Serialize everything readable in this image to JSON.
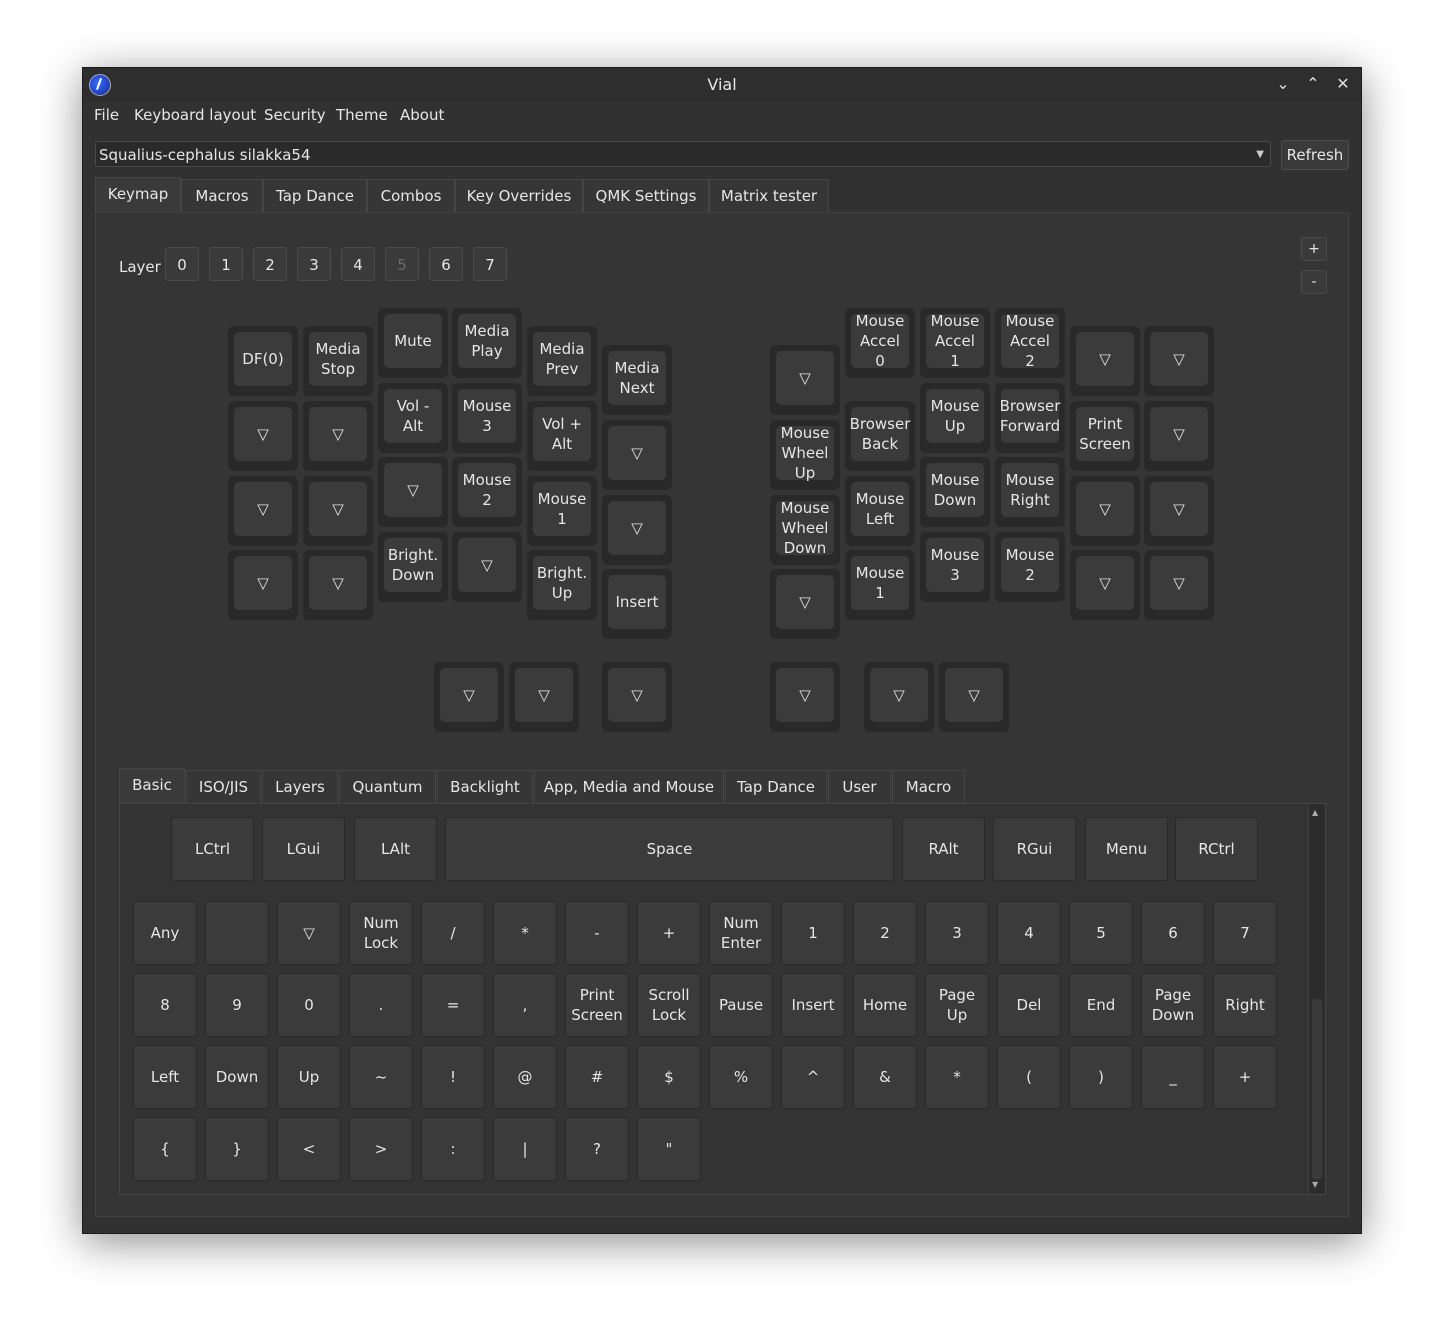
{
  "window": {
    "title": "Vial"
  },
  "menu": [
    "File",
    "Keyboard layout",
    "Security",
    "Theme",
    "About"
  ],
  "keyboard_selector": {
    "value": "Squalius-cephalus silakka54",
    "refresh_label": "Refresh"
  },
  "main_tabs": [
    "Keymap",
    "Macros",
    "Tap Dance",
    "Combos",
    "Key Overrides",
    "QMK Settings",
    "Matrix tester"
  ],
  "layer": {
    "label": "Layer",
    "buttons": [
      "0",
      "1",
      "2",
      "3",
      "4",
      "5",
      "6",
      "7"
    ],
    "plus": "+",
    "minus": "-"
  },
  "keymap_keys": [
    "DF(0)",
    "Media\nStop",
    "Mute",
    "Media\nPlay",
    "Media\nPrev",
    "Media\nNext",
    "▽",
    "▽",
    "Vol -\nAlt",
    "Mouse\n3",
    "Vol +\nAlt",
    "▽",
    "▽",
    "▽",
    "▽",
    "Mouse\n2",
    "Mouse\n1",
    "▽",
    "▽",
    "▽",
    "Bright.\nDown",
    "▽",
    "Bright.\nUp",
    "Insert",
    "▽",
    "Mouse\nAccel\n0",
    "Mouse\nAccel\n1",
    "Mouse\nAccel\n2",
    "▽",
    "▽",
    "Mouse\nWheel\nUp",
    "Browser\nBack",
    "Mouse\nUp",
    "Browser\nForward",
    "Print\nScreen",
    "▽",
    "Mouse\nWheel\nDown",
    "Mouse\nLeft",
    "Mouse\nDown",
    "Mouse\nRight",
    "▽",
    "▽",
    "▽",
    "Mouse\n1",
    "Mouse\n3",
    "Mouse\n2",
    "▽",
    "▽",
    "▽",
    "▽",
    "▽",
    "▽",
    "▽",
    "▽"
  ],
  "picker_tabs": [
    "Basic",
    "ISO/JIS",
    "Layers",
    "Quantum",
    "Backlight",
    "App, Media and Mouse",
    "Tap Dance",
    "User",
    "Macro"
  ],
  "picker_row_bottom": [
    "LCtrl",
    "LGui",
    "LAlt",
    "Space",
    "RAlt",
    "RGui",
    "Menu",
    "RCtrl"
  ],
  "picker_keys": [
    "Any",
    "",
    "▽",
    "Num\nLock",
    "/",
    "*",
    "-",
    "+",
    "Num\nEnter",
    "1",
    "2",
    "3",
    "4",
    "5",
    "6",
    "7",
    "8",
    "9",
    "0",
    ".",
    "=",
    ",",
    "Print\nScreen",
    "Scroll\nLock",
    "Pause",
    "Insert",
    "Home",
    "Page\nUp",
    "Del",
    "End",
    "Page\nDown",
    "Right",
    "Left",
    "Down",
    "Up",
    "~",
    "!",
    "@",
    "#",
    "$",
    "%",
    "^",
    "&",
    "*",
    "(",
    ")",
    "_",
    "+",
    "{",
    "}",
    "<",
    ">",
    ":",
    "|",
    "?",
    "\""
  ],
  "icons": {
    "app": "vial-app-icon",
    "minimize": "chevron-down-icon",
    "maximize": "chevron-up-icon",
    "close": "close-icon"
  }
}
